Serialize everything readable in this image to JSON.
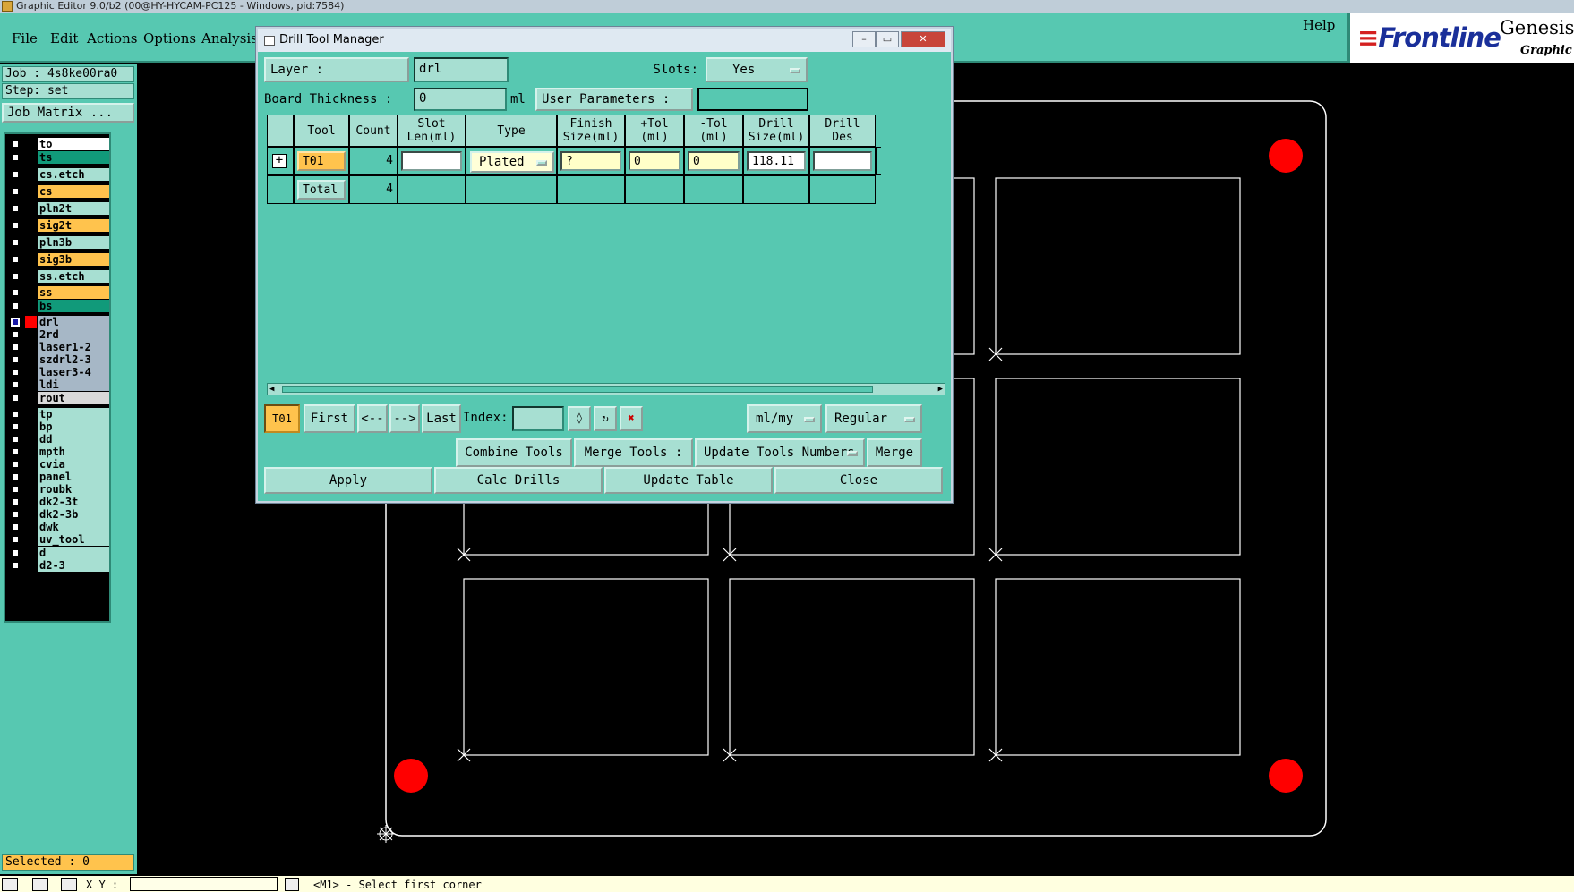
{
  "window_title": "Graphic Editor 9.0/b2 (00@HY-HYCAM-PC125 - Windows, pid:7584)",
  "menu": {
    "items": [
      "File",
      "Edit",
      "Actions",
      "Options",
      "Analysis"
    ],
    "help": "Help"
  },
  "logo": {
    "brand": "Frontline",
    "product": "Genesis",
    "subtitle": "Graphic E"
  },
  "job_panel": {
    "job": "Job : 4s8ke00ra0",
    "step": "Step: set",
    "job_matrix_button": "Job Matrix ...",
    "selected": "Selected : 0"
  },
  "layers": [
    {
      "name": "to",
      "color": "#ffffff"
    },
    {
      "name": "ts",
      "color": "#119a7a"
    },
    {
      "name": "cs.etch",
      "color": "#a7dfd2"
    },
    {
      "name": "cs",
      "color": "#ffc34d"
    },
    {
      "name": "pln2t",
      "color": "#a7dfd2"
    },
    {
      "name": "sig2t",
      "color": "#ffc34d"
    },
    {
      "name": "pln3b",
      "color": "#a7dfd2"
    },
    {
      "name": "sig3b",
      "color": "#ffc34d"
    },
    {
      "name": "ss.etch",
      "color": "#a7dfd2"
    },
    {
      "name": "ss",
      "color": "#ffc34d"
    },
    {
      "name": "bs",
      "color": "#119a7a"
    },
    {
      "name": "drl",
      "color": "#a6b7c6"
    },
    {
      "name": "2rd",
      "color": "#a6b7c6"
    },
    {
      "name": "laser1-2",
      "color": "#a6b7c6"
    },
    {
      "name": "szdrl2-3",
      "color": "#a6b7c6"
    },
    {
      "name": "laser3-4",
      "color": "#a6b7c6"
    },
    {
      "name": "ldi",
      "color": "#a6b7c6"
    },
    {
      "name": "rout",
      "color": "#d9d9d9"
    },
    {
      "name": "tp",
      "color": "#a7dfd2"
    },
    {
      "name": "bp",
      "color": "#a7dfd2"
    },
    {
      "name": "dd",
      "color": "#a7dfd2"
    },
    {
      "name": "mpth",
      "color": "#a7dfd2"
    },
    {
      "name": "cvia",
      "color": "#a7dfd2"
    },
    {
      "name": "panel",
      "color": "#a7dfd2"
    },
    {
      "name": "roubk",
      "color": "#a7dfd2"
    },
    {
      "name": "dk2-3t",
      "color": "#a7dfd2"
    },
    {
      "name": "dk2-3b",
      "color": "#a7dfd2"
    },
    {
      "name": "dwk",
      "color": "#a7dfd2"
    },
    {
      "name": "uv_tool",
      "color": "#a7dfd2"
    },
    {
      "name": "d",
      "color": "#a7dfd2"
    },
    {
      "name": "d2-3",
      "color": "#a7dfd2"
    }
  ],
  "dialog": {
    "title": "Drill Tool Manager",
    "layer_label": "Layer          :",
    "layer_value": "drl",
    "slots_label": "Slots:",
    "slots_value": "Yes",
    "board_thickness_label": "Board Thickness :",
    "board_thickness_value": "0",
    "board_thickness_unit": "ml",
    "user_parameters_label": "User Parameters :",
    "user_parameters_value": "",
    "columns": [
      "",
      "Tool",
      "Count",
      "Slot\nLen(ml)",
      "Type",
      "Finish\nSize(ml)",
      "+Tol\n(ml)",
      "-Tol\n(ml)",
      "Drill\nSize(ml)",
      "Drill\nDes"
    ],
    "row": {
      "tool": "T01",
      "count": "4",
      "slot_len": "",
      "type": "Plated",
      "finish_size": "?",
      "plus_tol": "0",
      "minus_tol": "0",
      "drill_size": "118.11",
      "drill_des": ""
    },
    "total_row": {
      "label": "Total",
      "count": "4"
    },
    "nav": {
      "current_tool": "T01",
      "first": "First",
      "prev": "<--",
      "next": "-->",
      "last": "Last",
      "index_label": "Index:",
      "index_value": "",
      "units": "ml/my",
      "mode": "Regular"
    },
    "combine_tools": "Combine Tools",
    "merge_tools_label": "Merge Tools  :",
    "update_tools_numbers": "Update Tools Numbers",
    "merge": "Merge",
    "apply": "Apply",
    "calc_drills": "Calc Drills",
    "update_table": "Update Table",
    "close": "Close"
  },
  "status": {
    "xy_label": "X Y :",
    "xy_value": "",
    "message": "<M1> - Select first corner"
  },
  "colors": {
    "panel_teal": "#57c8b1",
    "field_light": "#a7dfd2",
    "highlight_orange": "#ffc34d",
    "drill_hole_red": "#ff0000"
  }
}
